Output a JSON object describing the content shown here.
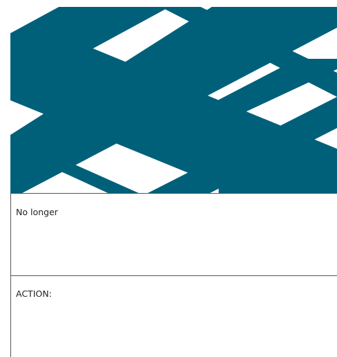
{
  "colors": {
    "pattern": "#00607A",
    "background": "#ffffff",
    "border": "#555555",
    "text": "#222222"
  },
  "panels": {
    "first": {
      "text": "No longer"
    },
    "second": {
      "text": "ACTION:"
    }
  }
}
